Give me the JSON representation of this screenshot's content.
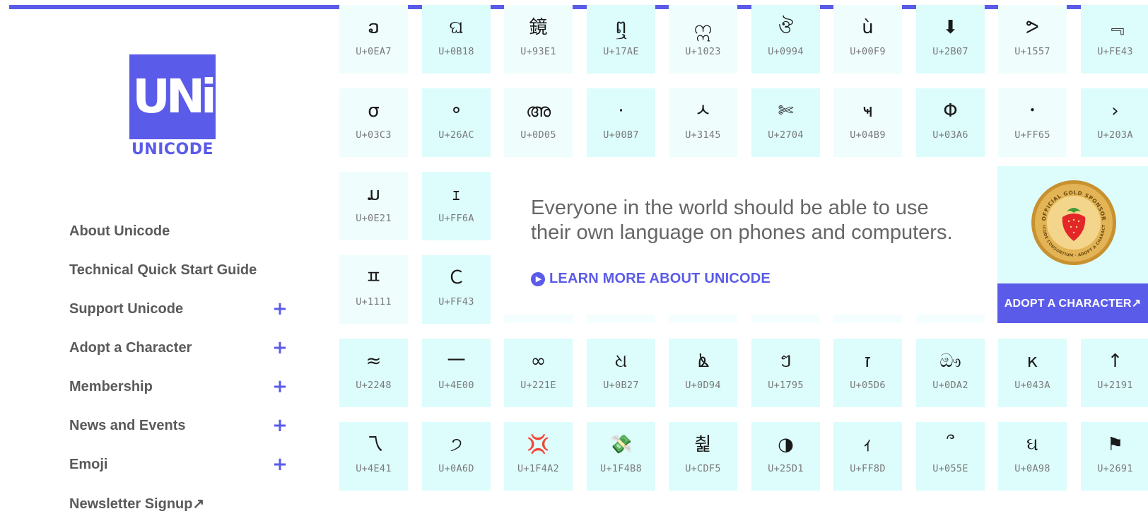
{
  "brand": {
    "logo_mark": "UNi",
    "logo_word": "UNICODE"
  },
  "sidebar": {
    "items": [
      {
        "label": "About Unicode",
        "expandable": false
      },
      {
        "label": "Technical Quick Start Guide",
        "expandable": false
      },
      {
        "label": "Support Unicode",
        "expandable": true
      },
      {
        "label": "Adopt a Character",
        "expandable": true
      },
      {
        "label": "Membership",
        "expandable": true
      },
      {
        "label": "News and Events",
        "expandable": true
      },
      {
        "label": "Emoji",
        "expandable": true
      },
      {
        "label": "Newsletter Signup↗",
        "expandable": false
      }
    ],
    "expand_symbol": "+"
  },
  "grid": {
    "row1": [
      {
        "glyph": "ວ",
        "code": "U+0EA7"
      },
      {
        "glyph": "ଘ",
        "code": "U+0B18"
      },
      {
        "glyph": "鏡",
        "code": "U+93E1"
      },
      {
        "glyph": "ឮ",
        "code": "U+17AE"
      },
      {
        "glyph": "ဣ",
        "code": "U+1023"
      },
      {
        "glyph": "ঔ",
        "code": "U+0994"
      },
      {
        "glyph": "ù",
        "code": "U+00F9"
      },
      {
        "glyph": "⬇",
        "code": "U+2B07"
      },
      {
        "glyph": "ᕗ",
        "code": "U+1557"
      },
      {
        "glyph": "﹃",
        "code": "U+FE43"
      }
    ],
    "row2": [
      {
        "glyph": "σ",
        "code": "U+03C3"
      },
      {
        "glyph": "⚬",
        "code": "U+26AC"
      },
      {
        "glyph": "അ",
        "code": "U+0D05"
      },
      {
        "glyph": "·",
        "code": "U+00B7"
      },
      {
        "glyph": "ㅅ",
        "code": "U+3145"
      },
      {
        "glyph": "✄",
        "code": "U+2704"
      },
      {
        "glyph": "ҹ",
        "code": "U+04B9"
      },
      {
        "glyph": "Φ",
        "code": "U+03A6"
      },
      {
        "glyph": "･",
        "code": "U+FF65"
      },
      {
        "glyph": "›",
        "code": "U+203A"
      }
    ],
    "row3": [
      {
        "glyph": "ມ",
        "code": "U+0E21"
      },
      {
        "glyph": "ｪ",
        "code": "U+FF6A"
      }
    ],
    "row4": [
      {
        "glyph": "ㅍ",
        "code": "U+1111"
      },
      {
        "glyph": "Ｃ",
        "code": "U+FF43"
      }
    ],
    "row5": [
      {
        "glyph": "≈",
        "code": "U+2248"
      },
      {
        "glyph": "一",
        "code": "U+4E00"
      },
      {
        "glyph": "∞",
        "code": "U+221E"
      },
      {
        "glyph": "ଧ",
        "code": "U+0B27"
      },
      {
        "glyph": "ൔ",
        "code": "U+0D94"
      },
      {
        "glyph": "ៗ",
        "code": "U+1795"
      },
      {
        "glyph": "ז",
        "code": "U+05D6"
      },
      {
        "glyph": "ඖ",
        "code": "U+0DA2"
      },
      {
        "glyph": "к",
        "code": "U+043A"
      },
      {
        "glyph": "↑",
        "code": "U+2191"
      }
    ],
    "row6": [
      {
        "glyph": "乁",
        "code": "U+4E41"
      },
      {
        "glyph": "੭",
        "code": "U+0A6D"
      },
      {
        "glyph": "💢",
        "code": "U+1F4A2"
      },
      {
        "glyph": "💸",
        "code": "U+1F4B8"
      },
      {
        "glyph": "췵",
        "code": "U+CDF5"
      },
      {
        "glyph": "◑",
        "code": "U+25D1"
      },
      {
        "glyph": "ｨ",
        "code": "U+FF8D"
      },
      {
        "glyph": "՞",
        "code": "U+055E"
      },
      {
        "glyph": "ઘ",
        "code": "U+0A98"
      },
      {
        "glyph": "⚑",
        "code": "U+2691"
      }
    ]
  },
  "hero": {
    "line1": "Everyone in the world should be able to use",
    "line2": "their own language on phones and computers.",
    "learn_more": "LEARN MORE ABOUT UNICODE"
  },
  "adopt_card": {
    "button_label": "ADOPT A CHARACTER↗",
    "seal_text_top": "OFFICIAL GOLD SPONSOR",
    "seal_text_bottom": "UNICODE CONSORTIUM · ADOPT A CHARACTER"
  },
  "colors": {
    "accent": "#5b5bea",
    "tile": "#ddfcfc",
    "text_gray": "#5a5a5a",
    "gold": "#d9a441"
  }
}
